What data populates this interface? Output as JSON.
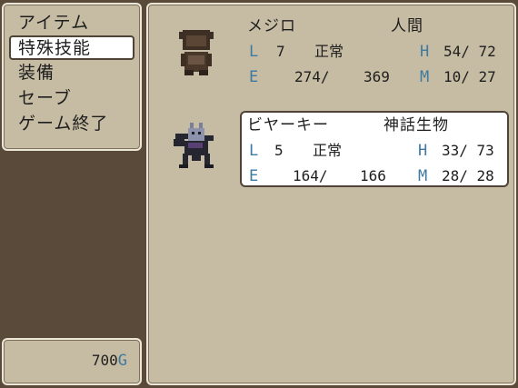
{
  "menu": {
    "items": [
      {
        "label": "アイテム",
        "selected": false
      },
      {
        "label": "特殊技能",
        "selected": true
      },
      {
        "label": "装備",
        "selected": false
      },
      {
        "label": "セーブ",
        "selected": false
      },
      {
        "label": "ゲーム終了",
        "selected": false
      }
    ]
  },
  "gold": {
    "amount": "700",
    "unit": "G"
  },
  "party": [
    {
      "name": "メジロ",
      "race": "人間",
      "level_label": "L",
      "level": "7",
      "status": "正常",
      "hp_label": "H",
      "hp": "54/ 72",
      "exp_label": "E",
      "exp": "274/",
      "exp_next": "369",
      "mp_label": "M",
      "mp": "10/ 27",
      "portrait_icon": "mejiro-portrait-icon"
    },
    {
      "name": "ビヤーキー",
      "race": "神話生物",
      "level_label": "L",
      "level": "5",
      "status": "正常",
      "hp_label": "H",
      "hp": "33/ 73",
      "exp_label": "E",
      "exp": "164/",
      "exp_next": "166",
      "mp_label": "M",
      "mp": "28/ 28",
      "portrait_icon": "byakhee-portrait-icon"
    }
  ],
  "colors": {
    "panel": "#c6bca3",
    "background": "#5a4a3a",
    "stat_letter": "#3f7aa0",
    "highlight": "#ffffff"
  }
}
